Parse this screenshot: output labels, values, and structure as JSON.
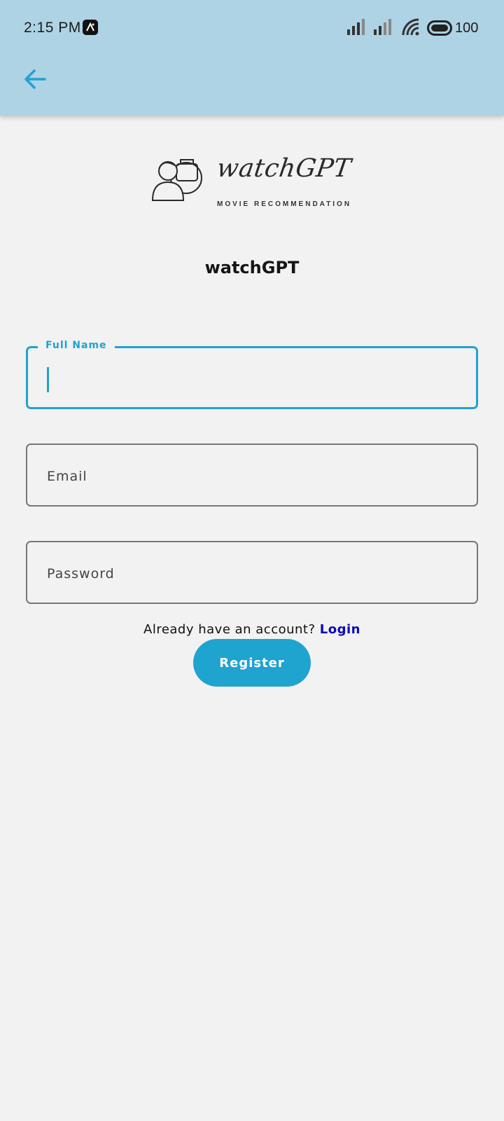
{
  "status_bar": {
    "time": "2:15 PM",
    "battery": "100",
    "icons": [
      "notification-app-icon",
      "signal-icon",
      "signal-icon",
      "wifi-icon",
      "battery-icon"
    ]
  },
  "header": {
    "back_icon": "arrow-left-icon"
  },
  "logo": {
    "script_text": "watchGPT",
    "subtitle": "MOVIE RECOMMENDATION"
  },
  "app_title": "watchGPT",
  "form": {
    "full_name": {
      "label": "Full Name",
      "value": ""
    },
    "email": {
      "placeholder": "Email",
      "value": ""
    },
    "password": {
      "placeholder": "Password",
      "value": ""
    }
  },
  "account_prompt": {
    "text": "Already have an account?",
    "link": "Login"
  },
  "register_label": "Register",
  "colors": {
    "app_bar": "#aed3e4",
    "accent": "#1fa3cf",
    "link": "#0b0bb8",
    "background": "#f2f2f2"
  }
}
